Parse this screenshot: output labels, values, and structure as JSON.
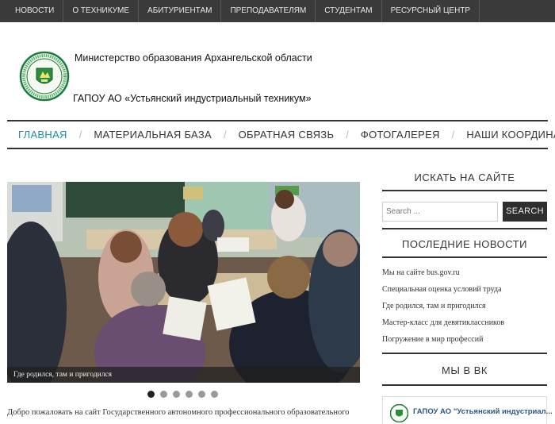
{
  "topnav": {
    "items": [
      "НОВОСТИ",
      "О ТЕХНИКУМЕ",
      "АБИТУРИЕНТАМ",
      "ПРЕПОДАВАТЕЛЯМ",
      "СТУДЕНТАМ",
      "РЕСУРСНЫЙ ЦЕНТР"
    ]
  },
  "header": {
    "ministry": "Министерство образования Архангельской области",
    "org_name": "ГАПОУ АО «Устьянский индустриальный техникум»"
  },
  "mainnav": {
    "items": [
      "ГЛАВНАЯ",
      "МАТЕРИАЛЬНАЯ БАЗА",
      "ОБРАТНАЯ СВЯЗЬ",
      "ФОТОГАЛЕРЕЯ",
      "НАШИ КООРДИНАТЫ"
    ],
    "separator": "/"
  },
  "slider": {
    "caption": "Где родился, там и пригодился",
    "slide_count": 6,
    "active_index": 0
  },
  "welcome_text": "Добро пожаловать на сайт Государственного автономного профессионального образовательного",
  "sidebar": {
    "search_title": "ИСКАТЬ НА САЙТЕ",
    "search_placeholder": "Search ...",
    "search_button": "SEARCH",
    "news_title": "ПОСЛЕДНИЕ НОВОСТИ",
    "news": [
      "Мы на сайте bus.gov.ru",
      "Специальная оценка условий труда",
      "Где родился, там и пригодился",
      "Мастер-класс для девятиклассников",
      "Погружение в мир профессий"
    ],
    "vk_title": "МЫ В ВК",
    "vk_group_name": "ГАПОУ АО \"Устьянский индустриал..."
  },
  "colors": {
    "topbar_bg": "#3a3a3a",
    "accent": "#1e8ea8",
    "vk_link": "#2a5885"
  }
}
